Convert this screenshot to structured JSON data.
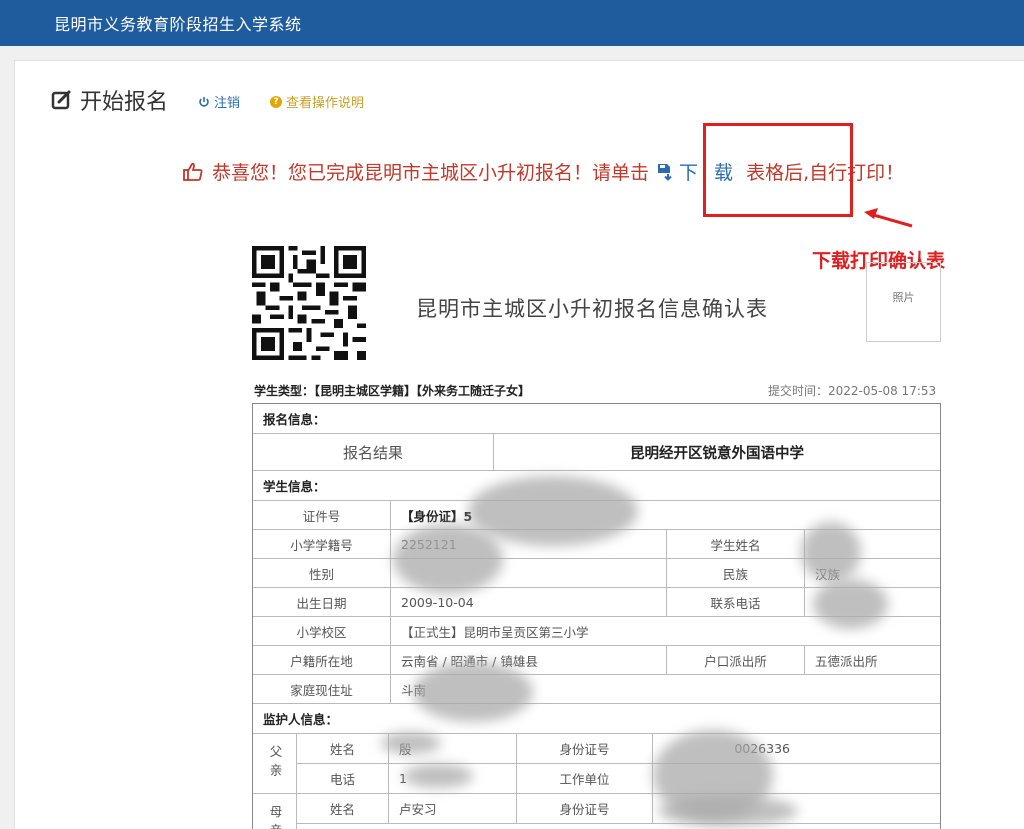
{
  "app_title": "昆明市义务教育阶段招生入学系统",
  "header": {
    "title": "开始报名",
    "logout_label": "注销",
    "help_label": "查看操作说明"
  },
  "message": {
    "before": "恭喜您！您已完成昆明市主城区小升初报名！请单击",
    "download_label": "下 载",
    "after": "表格后,自行打印！"
  },
  "annotation": "下载打印确认表",
  "form": {
    "title": "昆明市主城区小升初报名信息确认表",
    "photo_label": "照片",
    "student_type": "学生类型：【昆明主城区学籍】【外来务工随迁子女】",
    "submit_time": "提交时间：2022-05-08 17:53",
    "sections": {
      "registration": "报名信息：",
      "student": "学生信息：",
      "guardian": "监护人信息："
    },
    "registration": {
      "result_label": "报名结果",
      "result_value": "昆明经开区锐意外国语中学"
    },
    "student": {
      "id_label": "证件号",
      "id_value": "【身份证】5",
      "school_no_label": "小学学籍号",
      "school_no_value": "2252121",
      "name_label": "学生姓名",
      "gender_label": "性别",
      "ethnicity_label": "民族",
      "ethnicity_value": "汉族",
      "birth_label": "出生日期",
      "birth_value": "2009-10-04",
      "phone_label": "联系电话",
      "school_district_label": "小学校区",
      "school_district_value": "【正式生】昆明市呈贡区第三小学",
      "hukou_label": "户籍所在地",
      "hukou_value": "云南省 / 昭通市 / 镇雄县",
      "police_label": "户口派出所",
      "police_value": "五德派出所",
      "address_label": "家庭现住址",
      "address_value": "斗南"
    },
    "guardian": {
      "father_label": "父亲",
      "mother_label": "母亲",
      "name_label": "姓名",
      "id_label": "身份证号",
      "phone_label": "电话",
      "work_label": "工作单位",
      "father_name": "殷",
      "father_id": "0026336",
      "father_phone": "1",
      "mother_name": "卢安习"
    }
  },
  "colors": {
    "topbar": "#1f5c9e",
    "message": "#c0392b",
    "highlight": "#e02020",
    "link": "#2b6cb0"
  }
}
